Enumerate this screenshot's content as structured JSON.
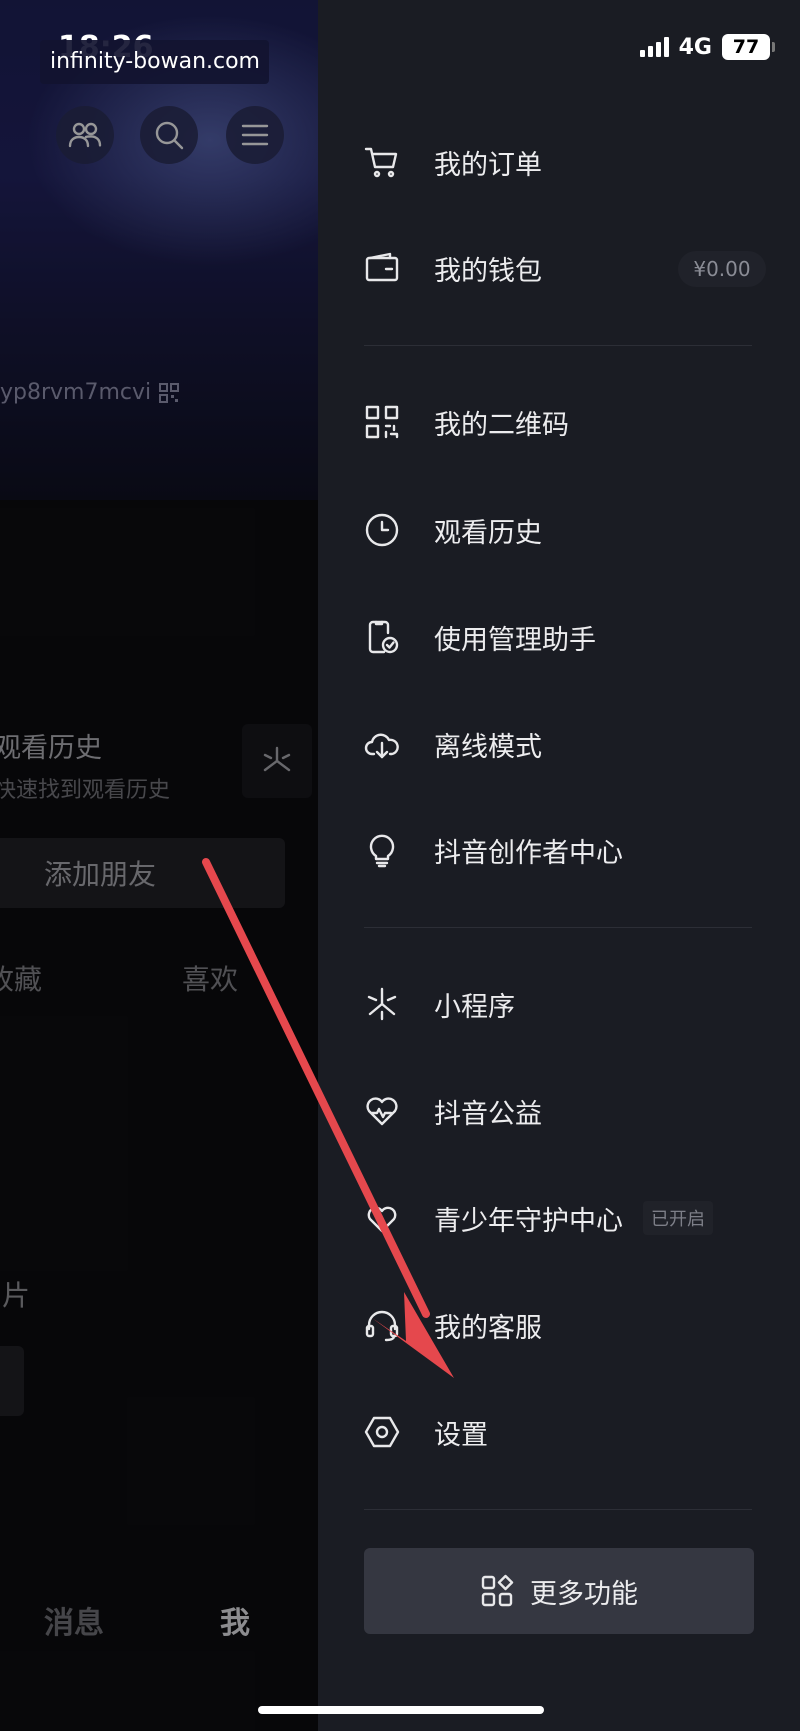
{
  "status_bar": {
    "time": "18:26",
    "network": "4G",
    "battery": "77"
  },
  "watermark": "infinity-bowan.com",
  "profile": {
    "uid": "yp8rvm7mcvi",
    "history_title": "观看历史",
    "history_sub": "快速找到观看历史",
    "add_friend": "添加朋友",
    "tab_favorites": "收藏",
    "tab_likes": "喜欢",
    "section_label": "片",
    "bottom_nav": [
      "消息",
      "我"
    ]
  },
  "drawer": {
    "items": [
      {
        "label": "我的订单",
        "icon": "cart-icon"
      },
      {
        "label": "我的钱包",
        "icon": "wallet-icon",
        "value": "¥0.00"
      },
      {
        "label": "我的二维码",
        "icon": "qrcode-icon"
      },
      {
        "label": "观看历史",
        "icon": "clock-icon"
      },
      {
        "label": "使用管理助手",
        "icon": "phone-check-icon"
      },
      {
        "label": "离线模式",
        "icon": "cloud-download-icon"
      },
      {
        "label": "抖音创作者中心",
        "icon": "lightbulb-icon"
      },
      {
        "label": "小程序",
        "icon": "miniprogram-icon"
      },
      {
        "label": "抖音公益",
        "icon": "heart-icon"
      },
      {
        "label": "青少年守护中心",
        "icon": "shield-heart-icon",
        "tag": "已开启"
      },
      {
        "label": "我的客服",
        "icon": "headset-icon"
      },
      {
        "label": "设置",
        "icon": "settings-hex-icon"
      }
    ],
    "more_button": "更多功能"
  },
  "colors": {
    "drawer_bg": "#1a1c23",
    "annotation_arrow": "#e5484d"
  }
}
